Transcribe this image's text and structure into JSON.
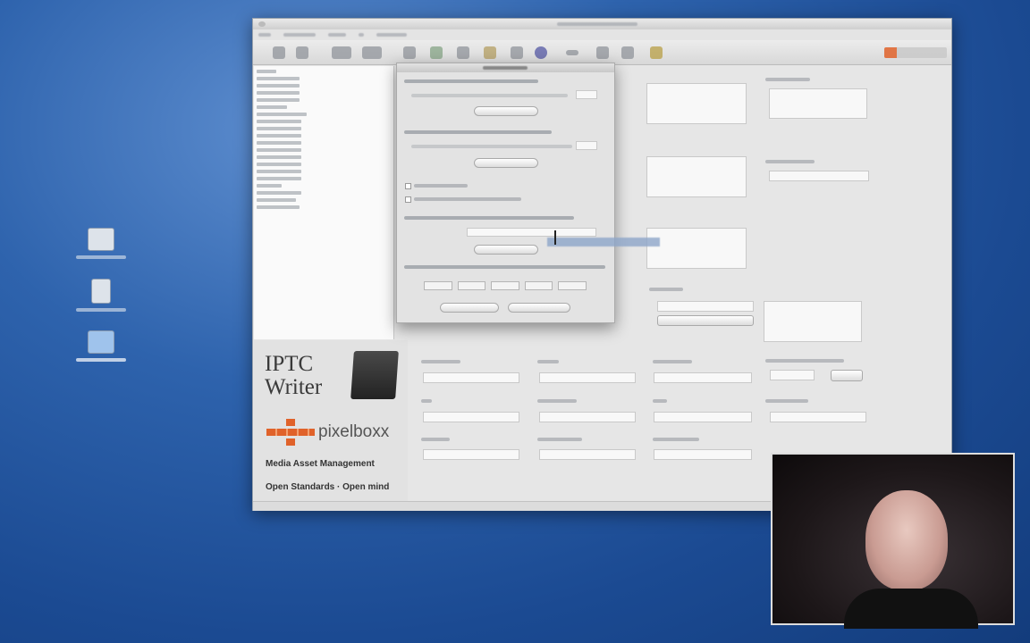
{
  "desktop": {
    "icons": [
      "document-icon",
      "file-icon",
      "folder-icon"
    ]
  },
  "app": {
    "logo": {
      "title_line1": "IPTC",
      "title_line2": "Writer",
      "brand": "pixelboxx",
      "tagline": "Media Asset Management",
      "slogan": "Open Standards · Open mind"
    }
  },
  "colors": {
    "brand_orange": "#e0622a",
    "desktop_blue": "#2e63ad"
  }
}
